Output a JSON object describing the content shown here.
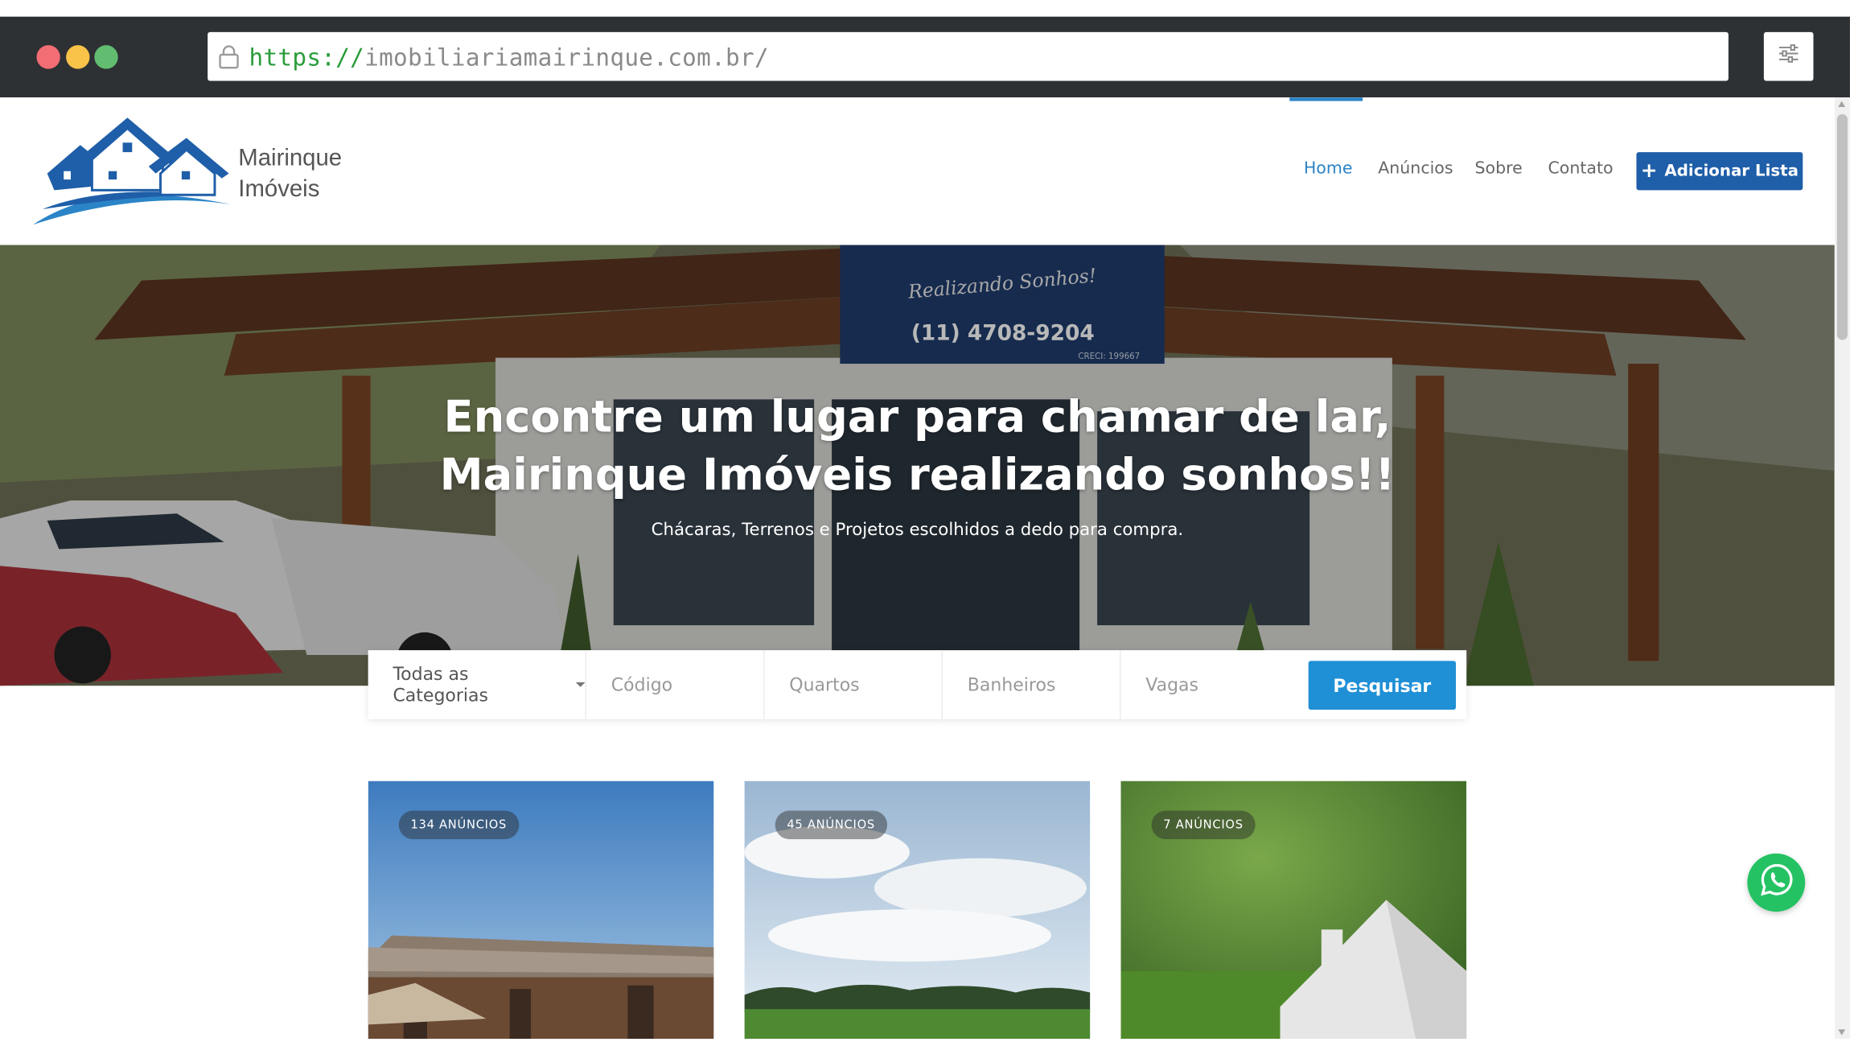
{
  "browser": {
    "url_scheme": "https://",
    "url_host": "imobiliariamairinque.com.br/",
    "lock_icon": "lock-icon",
    "menu_icon": "sliders-icon"
  },
  "header": {
    "logo_line1": "Mairinque",
    "logo_line2": "Imóveis",
    "nav": [
      {
        "label": "Home",
        "active": true
      },
      {
        "label": "Anúncios",
        "active": false
      },
      {
        "label": "Sobre",
        "active": false
      },
      {
        "label": "Contato",
        "active": false
      }
    ],
    "add_button": "Adicionar Lista",
    "accent_color": "#2b84c7",
    "button_color": "#1f5ea8"
  },
  "hero": {
    "title_line1": "Encontre um lugar para chamar de lar,",
    "title_line2": "Mairinque Imóveis realizando sonhos!!",
    "subtitle": "Chácaras, Terrenos e Projetos escolhidos a dedo para compra.",
    "sign_text": "Realizando Sonhos!",
    "sign_phone": "(11) 4708-9204",
    "sign_creci": "CRECI: 199667"
  },
  "search": {
    "category": "Todas as Categorias",
    "codigo_placeholder": "Código",
    "quartos_placeholder": "Quartos",
    "banheiros_placeholder": "Banheiros",
    "vagas_placeholder": "Vagas",
    "button": "Pesquisar",
    "button_color": "#1f8fd6"
  },
  "cards": [
    {
      "badge": "134 ANÚNCIOS"
    },
    {
      "badge": "45 ANÚNCIOS"
    },
    {
      "badge": "7 ANÚNCIOS"
    }
  ],
  "whatsapp_icon": "whatsapp-icon"
}
